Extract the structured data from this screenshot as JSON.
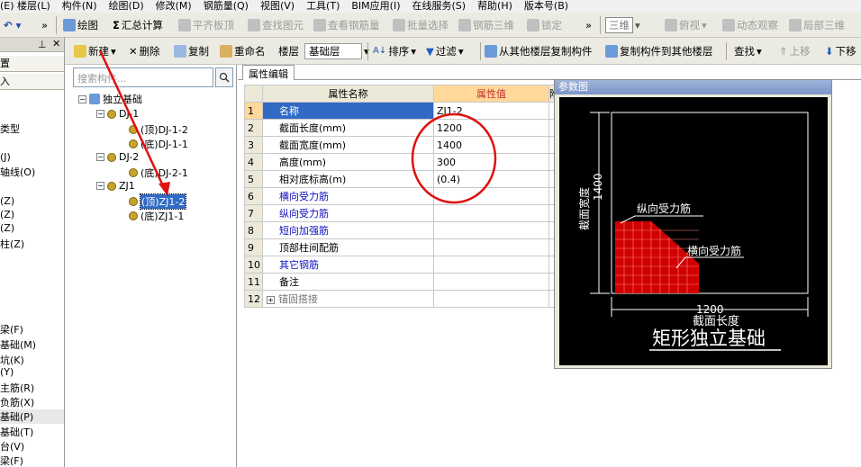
{
  "menu": [
    "(E) 楼层(L)",
    "构件(N)",
    "绘图(D)",
    "修改(M)",
    "钢筋量(Q)",
    "视图(V)",
    "工具(T)",
    "BIM应用(I)",
    "在线服务(S)",
    "帮助(H)",
    "版本号(B)"
  ],
  "toolbar1": {
    "draw": "绘图",
    "summary": "汇总计算",
    "level_slab": "平齐板顶",
    "find": "查找图元",
    "view_rebar": "查看钢筋量",
    "batch_select": "批量选择",
    "rebar_3d": "钢筋三维",
    "lock": "锁定",
    "view_3d": "三维",
    "top_view": "俯视",
    "dynamic": "动态观察",
    "local_3d": "局部三维"
  },
  "toolbar2": {
    "new": "新建",
    "delete": "删除",
    "copy": "复制",
    "rename": "重命名",
    "floor_label": "楼层",
    "floor_value": "基础层",
    "sort": "排序",
    "filter": "过滤",
    "copy_from": "从其他楼层复制构件",
    "copy_to": "复制构件到其他楼层",
    "find": "查找",
    "move_up": "上移",
    "move_down": "下移"
  },
  "left_panel": {
    "items": [
      "置",
      "入",
      "类型",
      "(J)",
      "轴线(O)",
      "(Z)",
      "(Z)",
      "(Z)",
      "柱(Z)",
      "梁(F)",
      "基础(M)",
      "坑(K)",
      "(Y)",
      "主筋(R)",
      "负筋(X)",
      "基础(P)",
      "基础(T)",
      "台(V)",
      "梁(F)"
    ]
  },
  "tree": {
    "search_placeholder": "搜索构件...",
    "root": "独立基础",
    "nodes": [
      {
        "label": "DJ-1",
        "children": [
          "(顶)DJ-1-2",
          "(底)DJ-1-1"
        ]
      },
      {
        "label": "DJ-2",
        "children": [
          "(底)DJ-2-1"
        ]
      },
      {
        "label": "ZJ1",
        "children": [
          "(顶)ZJ1-2",
          "(底)ZJ1-1"
        ]
      }
    ],
    "selected": "(顶)ZJ1-2"
  },
  "grid": {
    "tab": "属性编辑",
    "header_name": "属性名称",
    "header_value": "属性值",
    "header_extra": "附",
    "rows": [
      {
        "num": "1",
        "name": "名称",
        "value": "ZJ1-2"
      },
      {
        "num": "2",
        "name": "截面长度(mm)",
        "value": "1200"
      },
      {
        "num": "3",
        "name": "截面宽度(mm)",
        "value": "1400"
      },
      {
        "num": "4",
        "name": "高度(mm)",
        "value": "300"
      },
      {
        "num": "5",
        "name": "相对底标高(m)",
        "value": "(0.4)"
      },
      {
        "num": "6",
        "name": "横向受力筋",
        "value": ""
      },
      {
        "num": "7",
        "name": "纵向受力筋",
        "value": ""
      },
      {
        "num": "8",
        "name": "短向加强筋",
        "value": ""
      },
      {
        "num": "9",
        "name": "顶部柱间配筋",
        "value": ""
      },
      {
        "num": "10",
        "name": "其它钢筋",
        "value": ""
      },
      {
        "num": "11",
        "name": "备注",
        "value": ""
      },
      {
        "num": "12",
        "name": "锚固搭接",
        "value": ""
      }
    ]
  },
  "ref_panel": {
    "title": "参数图",
    "width_label": "截面宽度",
    "width_value": "1400",
    "length_label": "截面长度",
    "length_value": "1200",
    "long_rebar": "纵向受力筋",
    "trans_rebar": "横向受力筋",
    "caption": "矩形独立基础"
  },
  "colors": {
    "annotation_red": "#e01010",
    "selection_blue": "#316ac5",
    "header_orange": "#ffd89a"
  }
}
